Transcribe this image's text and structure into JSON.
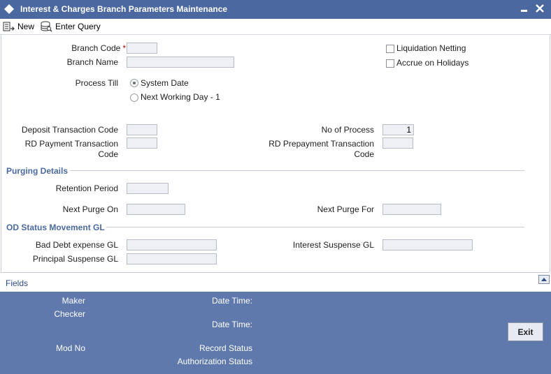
{
  "window": {
    "title": "Interest & Charges Branch Parameters Maintenance",
    "minimize": "▬",
    "close": "✕"
  },
  "toolbar": {
    "new_label": "New",
    "enter_query_label": "Enter Query"
  },
  "form": {
    "branch_code_label": "Branch Code",
    "required_mark": "*",
    "branch_code_value": "",
    "branch_name_label": "Branch Name",
    "branch_name_value": "",
    "liquidation_netting_label": "Liquidation Netting",
    "liquidation_netting_checked": false,
    "accrue_on_holidays_label": "Accrue on Holidays",
    "accrue_on_holidays_checked": false,
    "process_till_label": "Process Till",
    "process_till_options": [
      "System Date",
      "Next Working Day - 1"
    ],
    "process_till_selected": "System Date",
    "deposit_txn_code_label": "Deposit Transaction Code",
    "deposit_txn_code_value": "",
    "rd_payment_txn_code_label_1": "RD Payment Transaction",
    "rd_payment_txn_code_label_2": "Code",
    "rd_payment_txn_code_value": "",
    "no_of_process_label": "No of Process",
    "no_of_process_value": "1",
    "rd_prepayment_txn_code_label_1": "RD Prepayment Transaction",
    "rd_prepayment_txn_code_label_2": "Code",
    "rd_prepayment_txn_code_value": ""
  },
  "purging": {
    "section_title": "Purging Details",
    "retention_period_label": "Retention Period",
    "retention_period_value": "",
    "next_purge_on_label": "Next Purge On",
    "next_purge_on_value": "",
    "next_purge_for_label": "Next Purge For",
    "next_purge_for_value": ""
  },
  "od_status": {
    "section_title": "OD Status Movement GL",
    "bad_debt_label": "Bad Debt expense GL",
    "bad_debt_value": "",
    "interest_suspense_label": "Interest Suspense GL",
    "interest_suspense_value": "",
    "principal_suspense_label": "Principal Suspense GL",
    "principal_suspense_value": ""
  },
  "fields_bar": {
    "label": "Fields"
  },
  "footer": {
    "maker_label": "Maker",
    "checker_label": "Checker",
    "date_time_label_1": "Date Time:",
    "date_time_label_2": "Date Time:",
    "mod_no_label": "Mod No",
    "record_status_label": "Record Status",
    "authorization_status_label": "Authorization Status",
    "exit_label": "Exit"
  },
  "colors": {
    "titlebar": "#4b68a0",
    "footer": "#5f79ad",
    "section": "#4a69a1",
    "required": "#c00000"
  }
}
